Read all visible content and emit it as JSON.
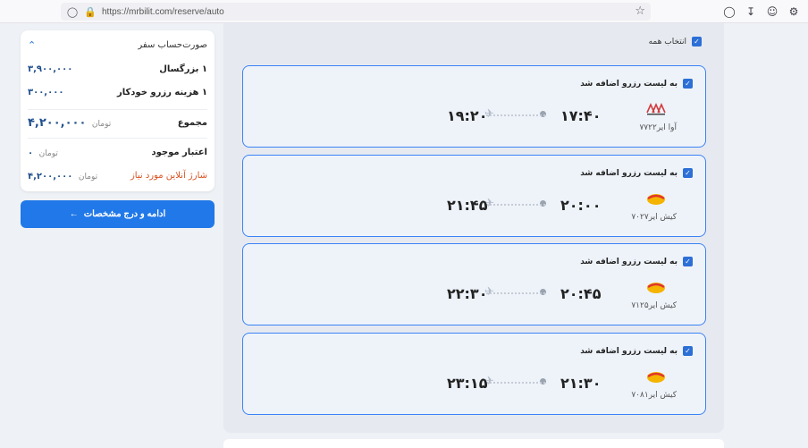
{
  "browser": {
    "url": "https://mrbilit.com/reserve/auto"
  },
  "summary": {
    "title": "صورت‌حساب سفر",
    "rows": [
      {
        "label": "۱ بزرگسال",
        "value": "۳,۹۰۰,۰۰۰"
      },
      {
        "label": "۱ هزینه رزرو خودکار",
        "value": "۳۰۰,۰۰۰"
      }
    ],
    "total_label": "مجموع",
    "total_value": "۴,۲۰۰,۰۰۰",
    "unit": "تومان",
    "credit_label": "اعتبار موجود",
    "credit_value": "۰",
    "charge_label": "شارژ آنلاین مورد نیاز",
    "charge_value": "۴,۲۰۰,۰۰۰"
  },
  "continue_button": "ادامه و درج مشخصات",
  "select_all_label": "انتخاب همه",
  "added_label": "به لیست رزرو اضافه شد",
  "flights": [
    {
      "airline": "آوا ایر۷۷۲۲",
      "logo": "ava-logo",
      "dep": "۱۷:۴۰",
      "arr": "۱۹:۲۰"
    },
    {
      "airline": "کیش ایر۷۰۲۷",
      "logo": "kish-logo",
      "dep": "۲۰:۰۰",
      "arr": "۲۱:۴۵"
    },
    {
      "airline": "کیش ایر۷۱۲۵",
      "logo": "kish-logo",
      "dep": "۲۰:۴۵",
      "arr": "۲۲:۳۰"
    },
    {
      "airline": "کیش ایر۷۰۸۱",
      "logo": "kish-logo",
      "dep": "۲۱:۳۰",
      "arr": "۲۳:۱۵"
    }
  ]
}
